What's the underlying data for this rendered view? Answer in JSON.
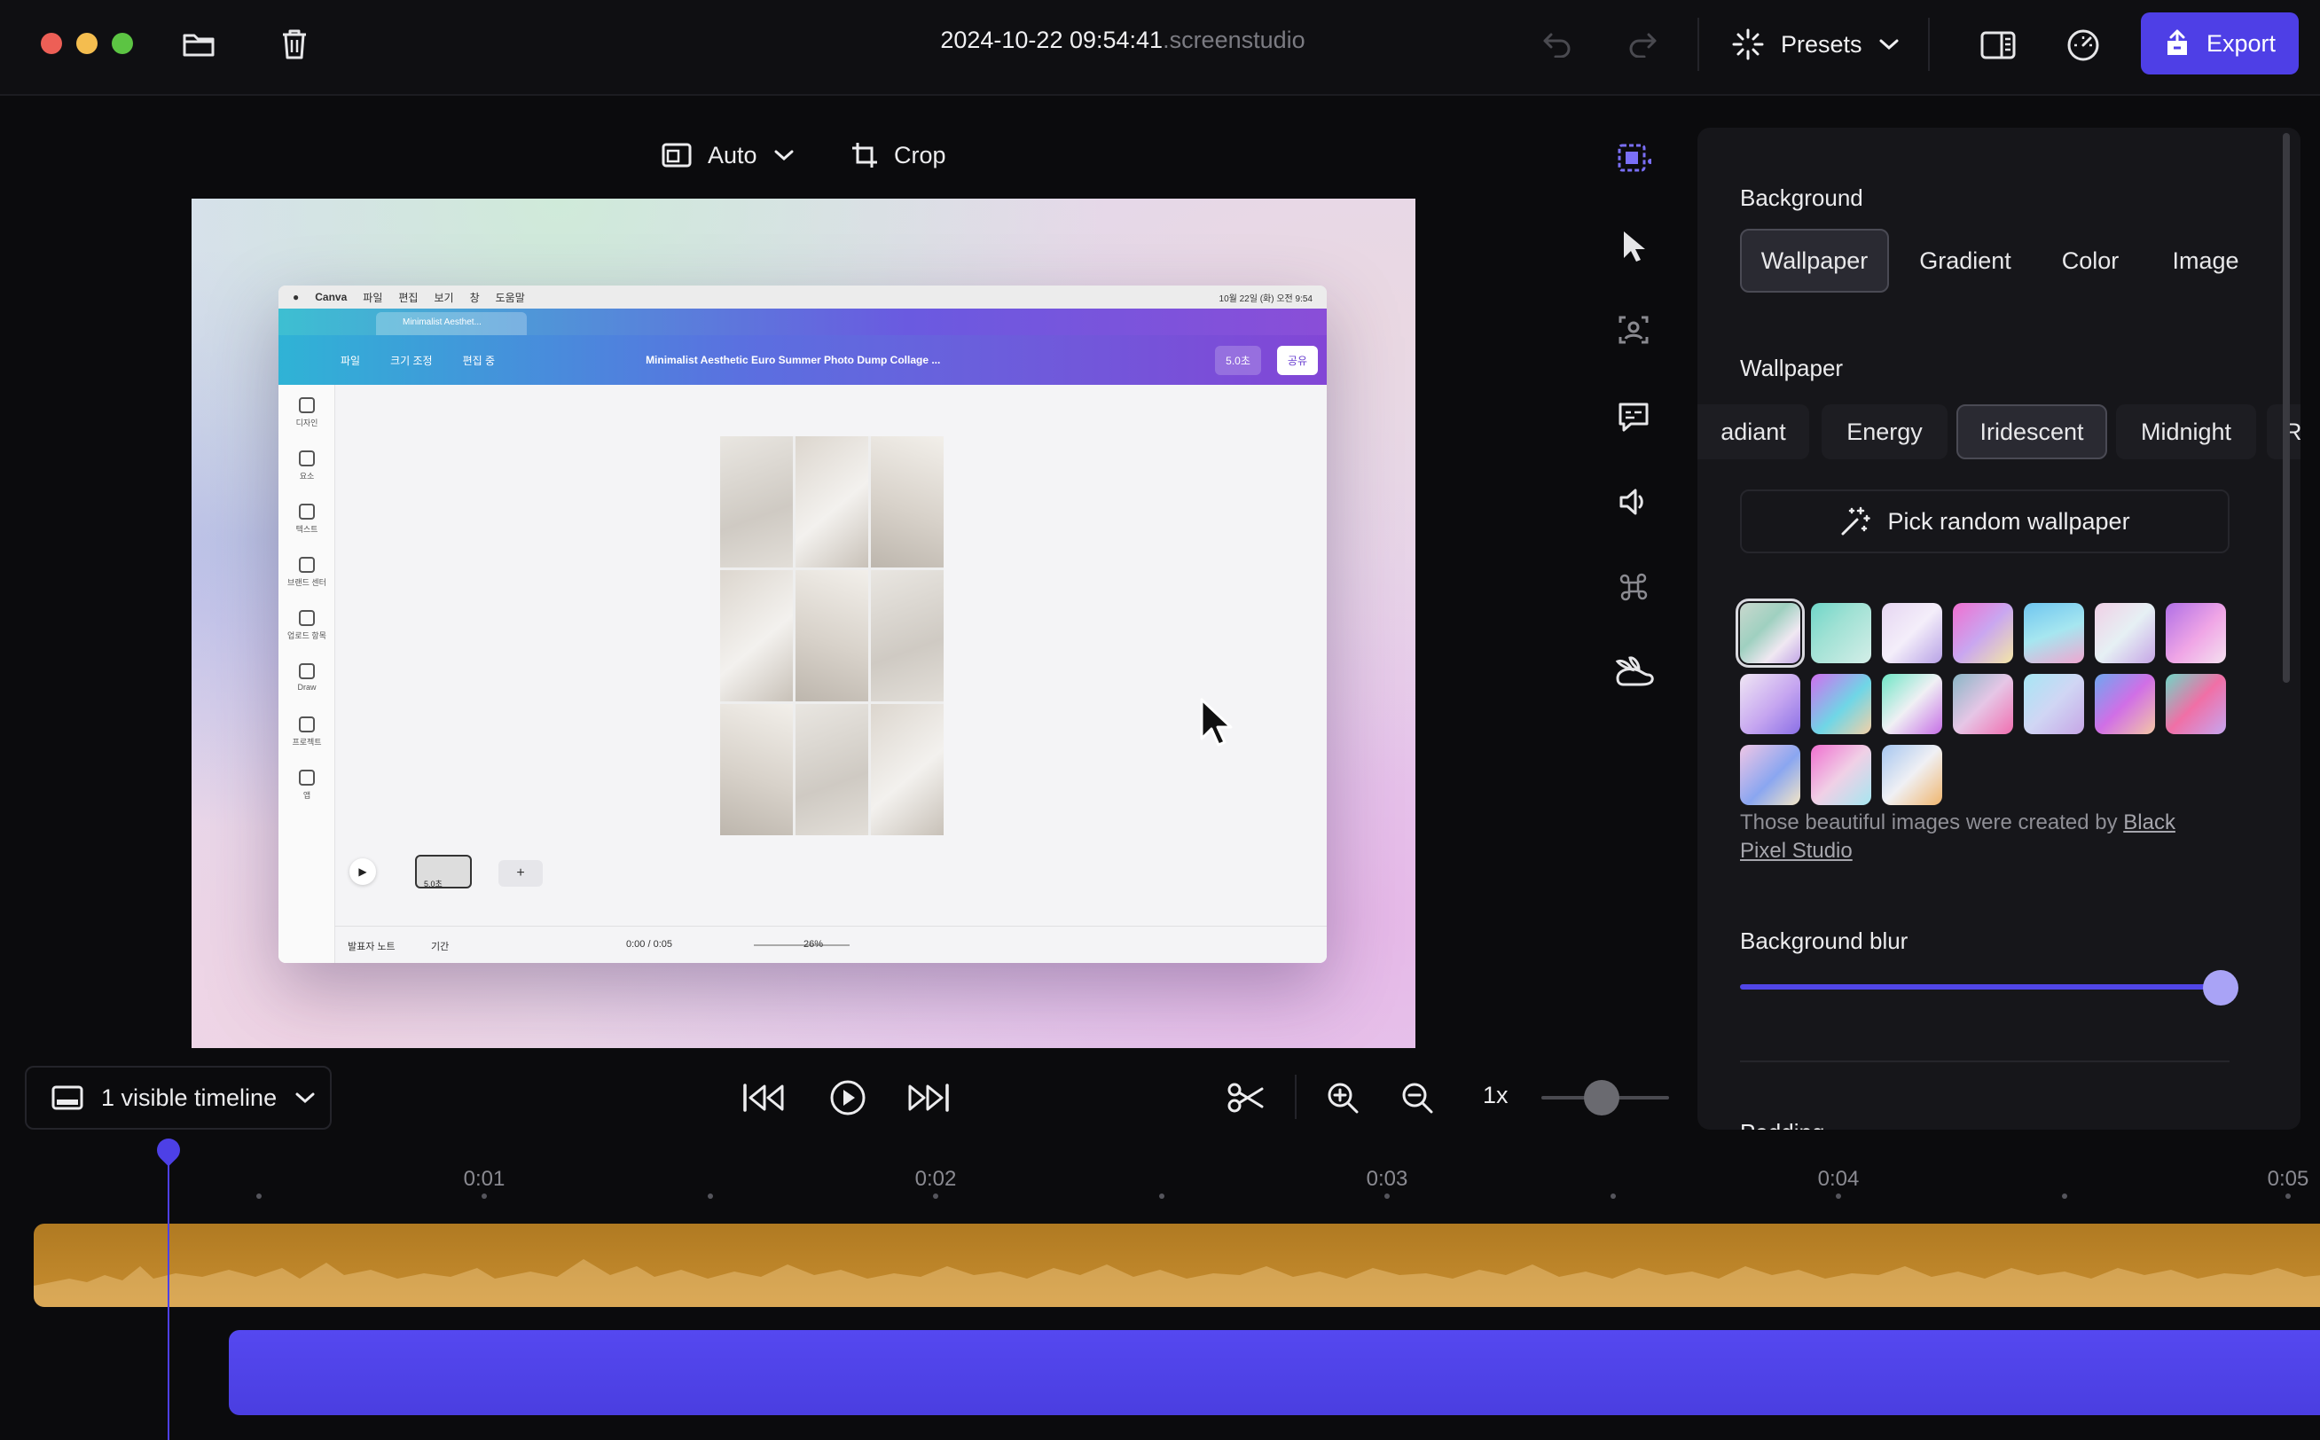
{
  "titlebar": {
    "filename": "2024-10-22 09:54:41",
    "extension": ".screenstudio",
    "presets_label": "Presets",
    "export_label": "Export"
  },
  "canvas_toolbar": {
    "aspect_label": "Auto",
    "crop_label": "Crop"
  },
  "recording": {
    "menubar_items": [
      "Canva",
      "파일",
      "편집",
      "보기",
      "창",
      "도움말"
    ],
    "menubar_clock": "10월 22일 (화) 오전 9:54",
    "tab_title": "Minimalist Aesthet...",
    "toolbar_items": [
      "파일",
      "크기 조정",
      "편집 중"
    ],
    "doc_title": "Minimalist Aesthetic Euro Summer Photo Dump Collage ...",
    "present_label": "5.0초",
    "share_label": "공유",
    "sidebar_items": [
      "디자인",
      "요소",
      "텍스트",
      "브랜드 센터",
      "업로드 항목",
      "Draw",
      "프로젝트",
      "앱"
    ],
    "page_thumb_label": "5.0초",
    "notes_label": "발표자 노트",
    "timer_label": "기간",
    "time_readout": "0:00 / 0:05",
    "zoom_label": "26%"
  },
  "panel": {
    "background_heading": "Background",
    "background_tabs": [
      "Wallpaper",
      "Gradient",
      "Color",
      "Image"
    ],
    "background_active": "Wallpaper",
    "wallpaper_heading": "Wallpaper",
    "wallpaper_chips": [
      "adiant",
      "Energy",
      "Iridescent",
      "Midnight",
      "Ray"
    ],
    "wallpaper_active": "Iridescent",
    "random_label": "Pick random wallpaper",
    "credit_text": "Those beautiful images were created by",
    "credit_link_a": "Black",
    "credit_link_b": "Pixel Studio",
    "blur_heading": "Background blur",
    "blur_value": 1.0,
    "next_heading_partial": "Padding"
  },
  "playback": {
    "timeline_select_label": "1 visible timeline",
    "speed_label": "1x",
    "zoom_level": 0.4
  },
  "timeline": {
    "ticks": [
      "0:01",
      "0:02",
      "0:03",
      "0:04",
      "0:05"
    ],
    "playhead_time": 0.0
  },
  "colors": {
    "accent": "#4e3fe6",
    "audio_track": "#c08a2c",
    "video_track": "#5246ec",
    "panel_bg": "#16161a"
  }
}
